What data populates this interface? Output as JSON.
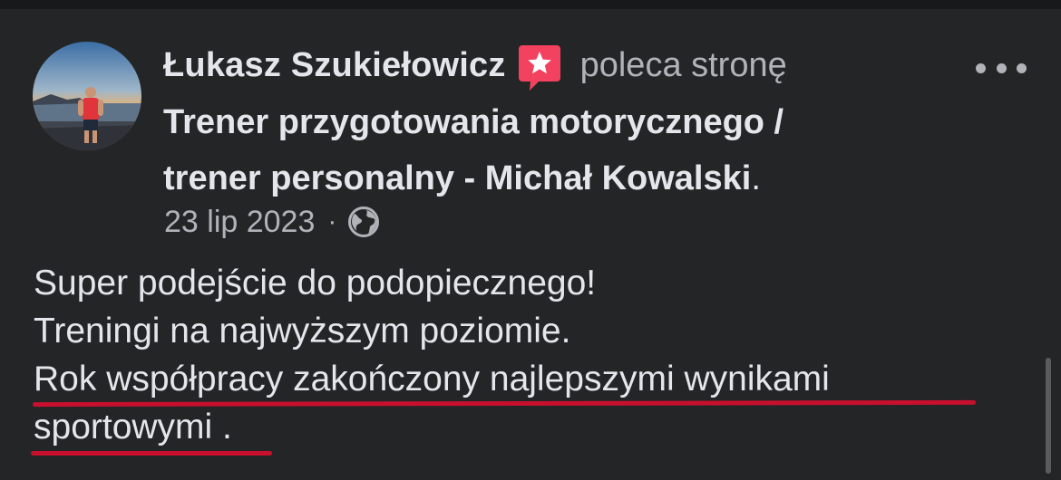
{
  "post": {
    "author": "Łukasz Szukiełowicz",
    "action": "poleca stronę",
    "page_name_line1": "Trener przygotowania motorycznego /",
    "page_name_line2": "trener personalny - Michał Kowalski",
    "page_name_end": ".",
    "date": "23 lip 2023",
    "separator": "·",
    "audience_icon": "globe-icon",
    "menu_icon": "more-horizontal-icon",
    "badge_icon": "recommendation-star-icon",
    "body_lines": [
      "Super podejście do podopiecznego!",
      "Treningi na najwyższym poziomie.",
      "Rok współpracy zakończony najlepszymi wynikami",
      "sportowymi ."
    ]
  },
  "colors": {
    "background": "#242526",
    "primary_text": "#e4e6eb",
    "secondary_text": "#b0b3b8",
    "badge": "#f3425f",
    "underline": "#c8102e"
  }
}
